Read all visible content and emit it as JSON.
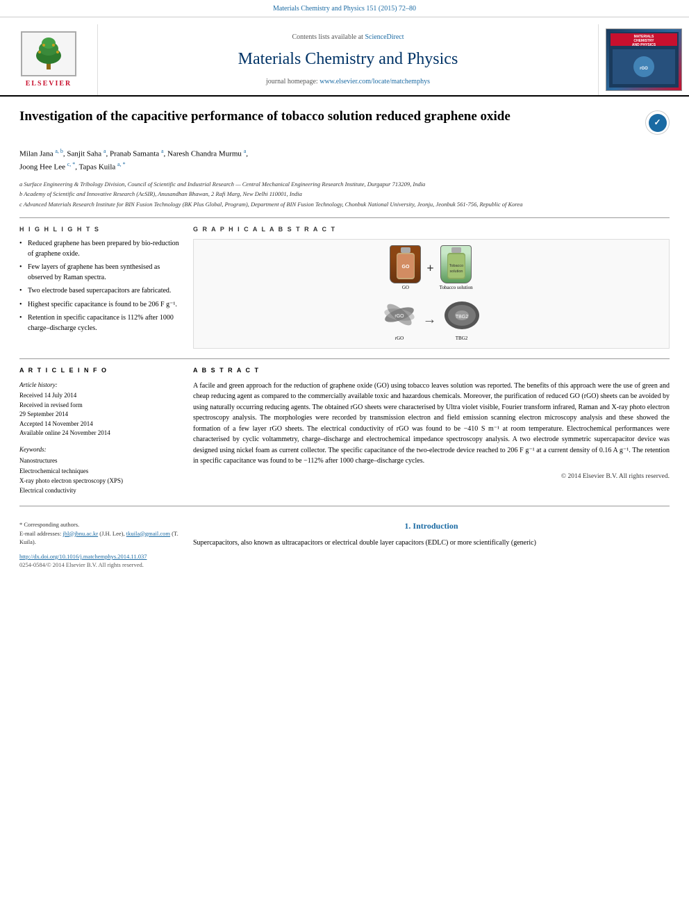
{
  "topBar": {
    "citation": "Materials Chemistry and Physics 151 (2015) 72–80"
  },
  "journalHeader": {
    "contentsLine": "Contents lists available at",
    "contentsLink": "ScienceDirect",
    "journalTitle": "Materials Chemistry and Physics",
    "homepageLabel": "journal homepage:",
    "homepageLink": "www.elsevier.com/locate/matchemphys",
    "elsevierText": "ELSEVIER",
    "coverTitle": "MATERIALS\nCHEMISTRY\nAND PHYSICS"
  },
  "article": {
    "title": "Investigation of the capacitive performance of tobacco solution reduced graphene oxide",
    "authors": "Milan Jana a, b, Sanjit Saha a, Pranab Samanta a, Naresh Chandra Murmu a, Joong Hee Lee c, *, Tapas Kuila a, *",
    "affiliationA": "a Surface Engineering & Tribology Division, Council of Scientific and Industrial Research — Central Mechanical Engineering Research Institute, Durgapur 713209, India",
    "affiliationB": "b Academy of Scientific and Innovative Research (AcSIR), Anusandhan Bhawan, 2 Rafi Marg, New Delhi 110001, India",
    "affiliationC": "c Advanced Materials Research Institute for BIN Fusion Technology (BK Plus Global, Program), Department of BIN Fusion Technology, Chonbuk National University, Jeonju, Jeonbuk 561-756, Republic of Korea"
  },
  "highlights": {
    "sectionLabel": "H I G H L I G H T S",
    "items": [
      "Reduced graphene has been prepared by bio-reduction of graphene oxide.",
      "Few layers of graphene has been synthesised as observed by Raman spectra.",
      "Two electrode based supercapacitors are fabricated.",
      "Highest specific capacitance is found to be 206 F g⁻¹.",
      "Retention in specific capacitance is 112% after 1000 charge–discharge cycles."
    ]
  },
  "graphicalAbstract": {
    "sectionLabel": "G R A P H I C A L   A B S T R A C T",
    "goLabel": "GO",
    "tobaccoLabel": "Tobacco\nsolution",
    "rgoLabel": "rGO",
    "tbg2Label": "TBG2"
  },
  "articleInfo": {
    "sectionLabel": "A R T I C L E   I N F O",
    "historyTitle": "Article history:",
    "received": "Received 14 July 2014",
    "receivedRevised": "Received in revised form",
    "revisedDate": "29 September 2014",
    "accepted": "Accepted 14 November 2014",
    "availableOnline": "Available online 24 November 2014",
    "keywordsTitle": "Keywords:",
    "keyword1": "Nanostructures",
    "keyword2": "Electrochemical techniques",
    "keyword3": "X-ray photo electron spectroscopy (XPS)",
    "keyword4": "Electrical conductivity"
  },
  "abstract": {
    "sectionLabel": "A B S T R A C T",
    "text": "A facile and green approach for the reduction of graphene oxide (GO) using tobacco leaves solution was reported. The benefits of this approach were the use of green and cheap reducing agent as compared to the commercially available toxic and hazardous chemicals. Moreover, the purification of reduced GO (rGO) sheets can be avoided by using naturally occurring reducing agents. The obtained rGO sheets were characterised by Ultra violet visible, Fourier transform infrared, Raman and X-ray photo electron spectroscopy analysis. The morphologies were recorded by transmission electron and field emission scanning electron microscopy analysis and these showed the formation of a few layer rGO sheets. The electrical conductivity of rGO was found to be −410 S m⁻¹ at room temperature. Electrochemical performances were characterised by cyclic voltammetry, charge–discharge and electrochemical impedance spectroscopy analysis. A two electrode symmetric supercapacitor device was designed using nickel foam as current collector. The specific capacitance of the two-electrode device reached to 206 F g⁻¹ at a current density of 0.16 A g⁻¹. The retention in specific capacitance was found to be −112% after 1000 charge–discharge cycles.",
    "copyright": "© 2014 Elsevier B.V. All rights reserved."
  },
  "introduction": {
    "heading": "1.  Introduction",
    "text": "Supercapacitors, also known as ultracapacitors or electrical double layer capacitors (EDLC) or more scientifically (generic)"
  },
  "footer": {
    "correspondingNote": "* Corresponding authors.",
    "emailLabel": "E-mail addresses:",
    "email1": "jhl@jbnu.ac.kr",
    "email1Person": "(J.H. Lee),",
    "email2": "tkuila@gmail.com",
    "email2Person": "(T. Kuila).",
    "doi": "http://dx.doi.org/10.1016/j.matchemphys.2014.11.037",
    "issn": "0254-0584/© 2014 Elsevier B.V. All rights reserved."
  }
}
